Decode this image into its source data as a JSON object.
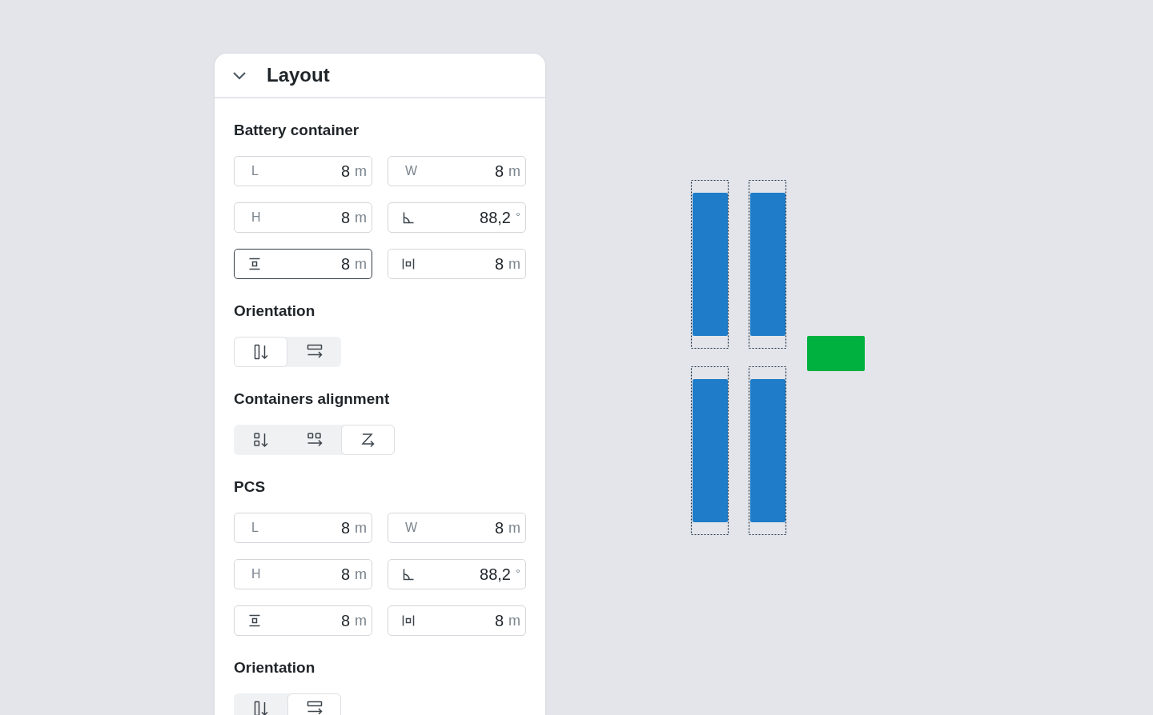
{
  "panel": {
    "title": "Layout",
    "expanded": true,
    "sections": [
      {
        "kind": "fields",
        "heading": "Battery container",
        "fields": [
          {
            "kind": "text",
            "label": "L",
            "value": "8",
            "unit": "m",
            "focused": false
          },
          {
            "kind": "text",
            "label": "W",
            "value": "8",
            "unit": "m",
            "focused": false
          },
          {
            "kind": "text",
            "label": "H",
            "value": "8",
            "unit": "m",
            "focused": false
          },
          {
            "kind": "angle",
            "value": "88,2",
            "unit": "°",
            "focused": false
          },
          {
            "kind": "gap-vertical",
            "value": "8",
            "unit": "m",
            "focused": true
          },
          {
            "kind": "gap-horizontal",
            "value": "8",
            "unit": "m",
            "focused": false
          }
        ]
      },
      {
        "kind": "segments",
        "heading": "Orientation",
        "options": [
          {
            "kind": "vertical",
            "selected": true
          },
          {
            "kind": "horizontal",
            "selected": false
          }
        ]
      },
      {
        "kind": "segments",
        "heading": "Containers alignment",
        "options": [
          {
            "kind": "stack-vertical",
            "selected": false
          },
          {
            "kind": "stack-horizontal",
            "selected": false
          },
          {
            "kind": "zigzag",
            "selected": true
          }
        ]
      },
      {
        "kind": "fields",
        "heading": "PCS",
        "fields": [
          {
            "kind": "text",
            "label": "L",
            "value": "8",
            "unit": "m",
            "focused": false
          },
          {
            "kind": "text",
            "label": "W",
            "value": "8",
            "unit": "m",
            "focused": false
          },
          {
            "kind": "text",
            "label": "H",
            "value": "8",
            "unit": "m",
            "focused": false
          },
          {
            "kind": "angle",
            "value": "88,2",
            "unit": "°",
            "focused": false
          },
          {
            "kind": "gap-vertical",
            "value": "8",
            "unit": "m",
            "focused": false
          },
          {
            "kind": "gap-horizontal",
            "value": "8",
            "unit": "m",
            "focused": false
          }
        ]
      },
      {
        "kind": "segments",
        "heading": "Orientation",
        "options": [
          {
            "kind": "vertical",
            "selected": false
          },
          {
            "kind": "horizontal",
            "selected": true
          }
        ]
      }
    ]
  },
  "canvas": {
    "blocks": [
      {
        "kind": "container",
        "color": "#1e7cc9"
      },
      {
        "kind": "container",
        "color": "#1e7cc9"
      },
      {
        "kind": "container",
        "color": "#1e7cc9"
      },
      {
        "kind": "container",
        "color": "#1e7cc9"
      },
      {
        "kind": "pcs",
        "color": "#00b13f"
      }
    ]
  }
}
